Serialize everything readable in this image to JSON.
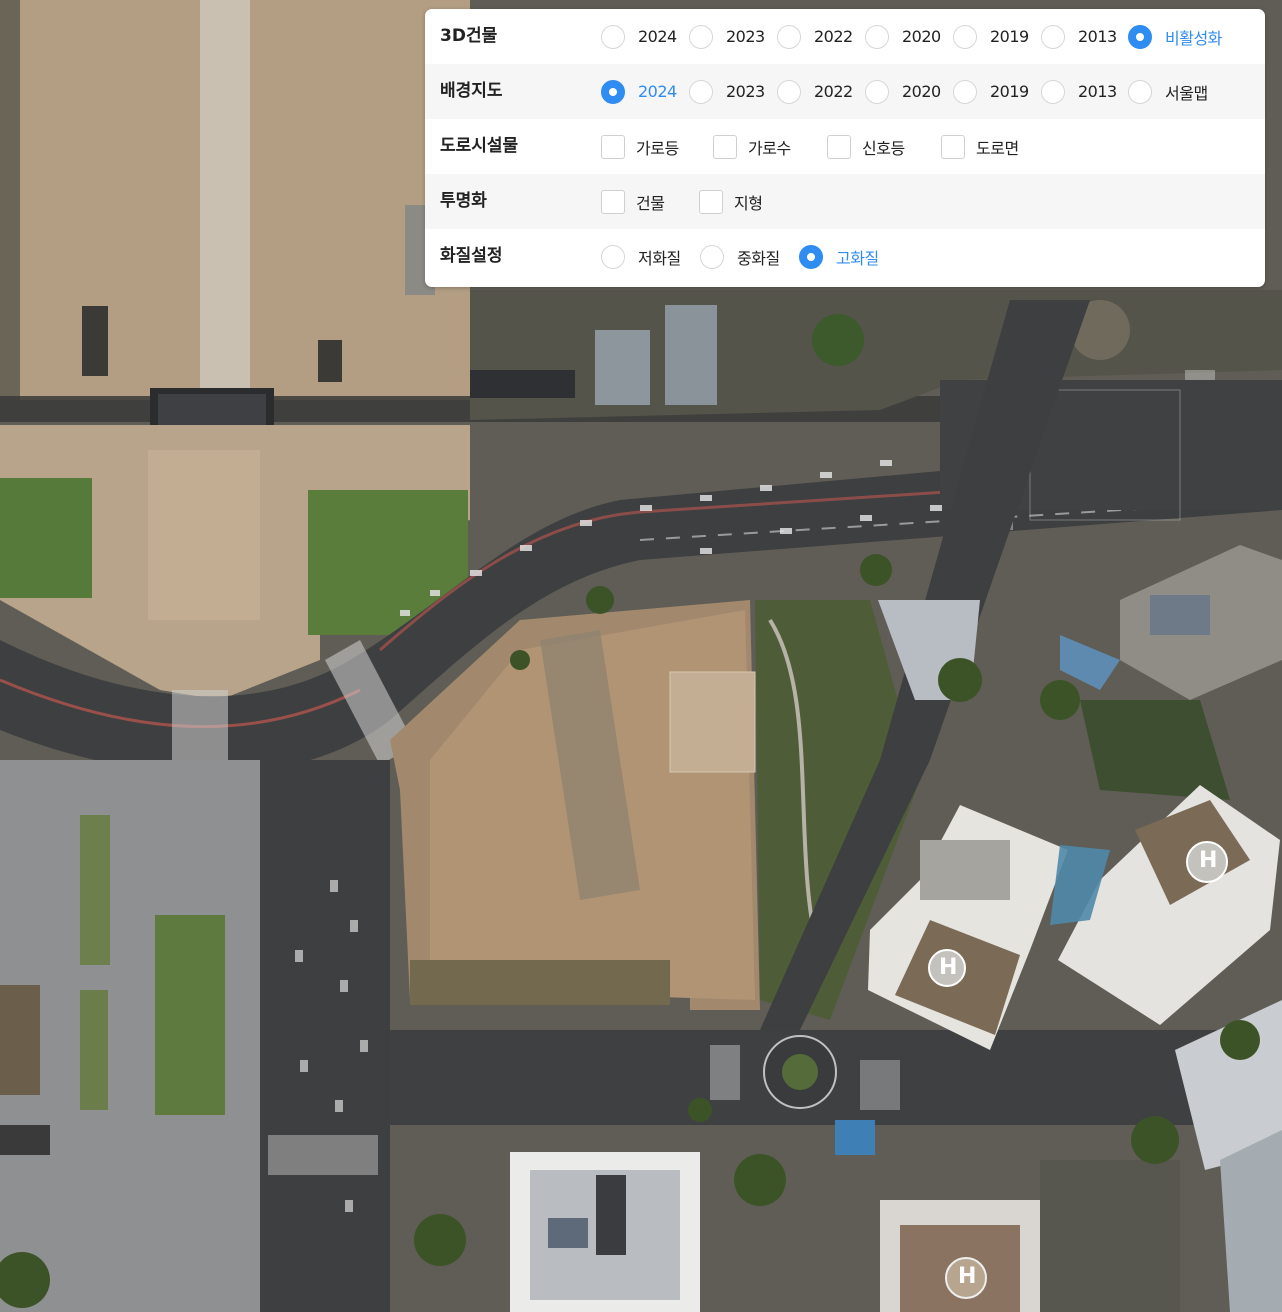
{
  "panel": {
    "rows": [
      {
        "label": "3D건물",
        "type": "radio",
        "options": [
          "2024",
          "2023",
          "2022",
          "2020",
          "2019",
          "2013",
          "비활성화"
        ],
        "selected": 6
      },
      {
        "label": "배경지도",
        "type": "radio",
        "options": [
          "2024",
          "2023",
          "2022",
          "2020",
          "2019",
          "2013",
          "서울맵"
        ],
        "selected": 0
      },
      {
        "label": "도로시설물",
        "type": "checkbox",
        "options": [
          "가로등",
          "가로수",
          "신호등",
          "도로면"
        ],
        "checked": [
          false,
          false,
          false,
          false
        ]
      },
      {
        "label": "투명화",
        "type": "checkbox",
        "options": [
          "건물",
          "지형"
        ],
        "checked": [
          false,
          false
        ]
      },
      {
        "label": "화질설정",
        "type": "radio",
        "options": [
          "저화질",
          "중화질",
          "고화질"
        ],
        "selected": 2
      }
    ]
  },
  "colors": {
    "accent": "#2f8cf0",
    "label": "#222222",
    "panel_bg": "#ffffff",
    "row_alt": "#f6f6f6"
  },
  "map": {
    "icons": [
      "helipad-icon",
      "helipad-icon",
      "helipad-icon"
    ]
  }
}
